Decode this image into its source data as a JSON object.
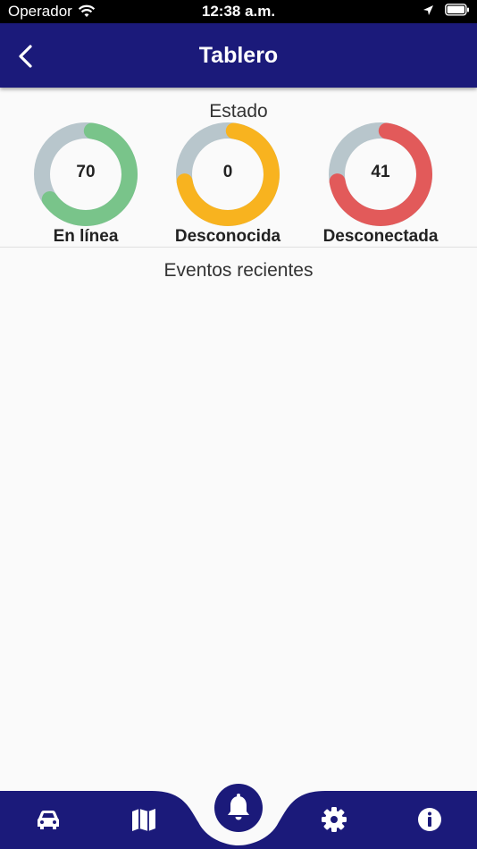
{
  "status_bar": {
    "carrier": "Operador",
    "time": "12:38 a.m."
  },
  "header": {
    "title": "Tablero"
  },
  "estado": {
    "title": "Estado",
    "gauges": [
      {
        "value": "70",
        "label": "En línea",
        "color": "#79c48a",
        "fraction": 0.63
      },
      {
        "value": "0",
        "label": "Desconocida",
        "color": "#f8b31f",
        "fraction": 0.7
      },
      {
        "value": "41",
        "label": "Desconectada",
        "color": "#e25a5a",
        "fraction": 0.7
      }
    ],
    "track_color": "#b8c6cc"
  },
  "events": {
    "title": "Eventos recientes",
    "items": []
  },
  "nav": {
    "items": [
      "car-icon",
      "map-icon",
      "bell-icon",
      "gear-icon",
      "info-icon"
    ],
    "active": "bell-icon"
  },
  "colors": {
    "primary": "#1b1a7a",
    "background": "#fafafa"
  }
}
